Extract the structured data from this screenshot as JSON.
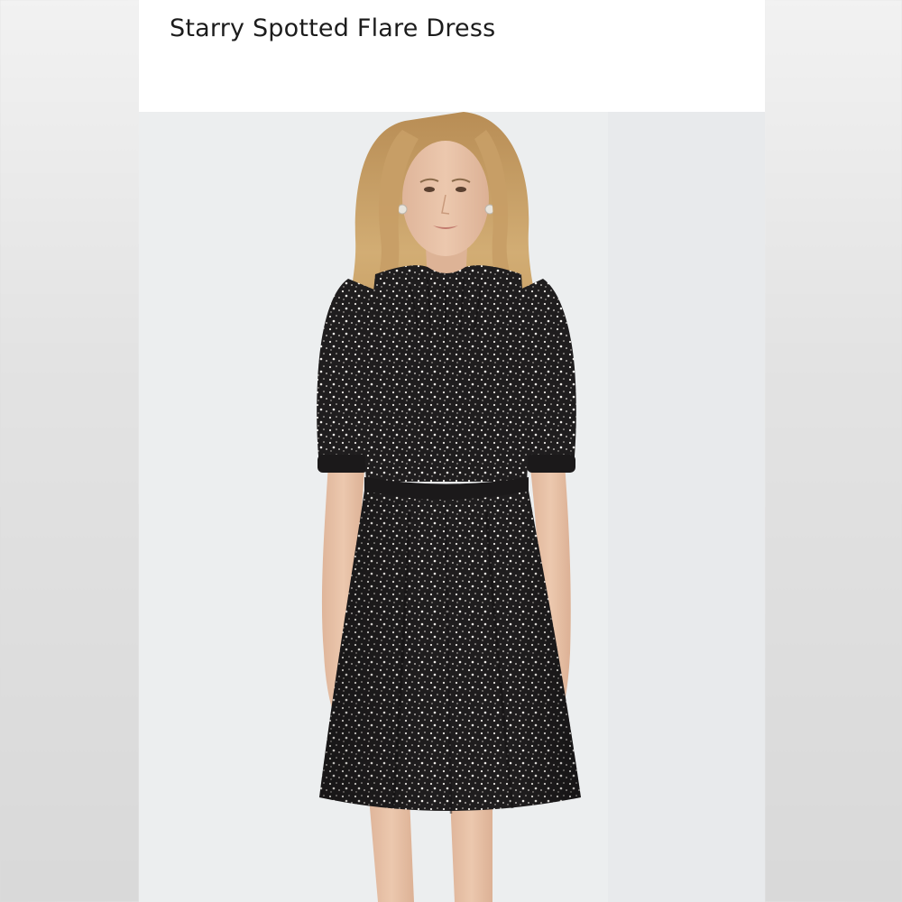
{
  "product": {
    "title": "Starry Spotted Flare Dress"
  },
  "photo": {
    "subject": "model-wearing-dress",
    "dress_color": "#1f1d1e",
    "dot_color": "#e9e6e2",
    "hair_color": "#c9a26a",
    "skin_color": "#e8c3a8",
    "background_color": "#eceeef"
  }
}
